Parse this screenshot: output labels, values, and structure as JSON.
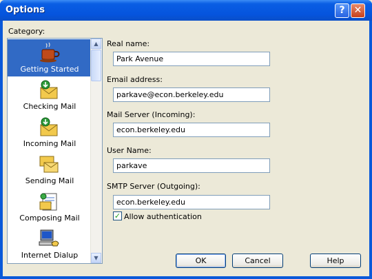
{
  "window": {
    "title": "Options"
  },
  "sidebar": {
    "label": "Category:",
    "items": [
      {
        "label": "Getting Started",
        "icon": "coffee-cup-icon",
        "selected": true
      },
      {
        "label": "Checking Mail",
        "icon": "mail-download-icon",
        "selected": false
      },
      {
        "label": "Incoming Mail",
        "icon": "mail-download-icon",
        "selected": false
      },
      {
        "label": "Sending Mail",
        "icon": "envelope-send-icon",
        "selected": false
      },
      {
        "label": "Composing Mail",
        "icon": "compose-mail-icon",
        "selected": false
      },
      {
        "label": "Internet Dialup",
        "icon": "computer-phone-icon",
        "selected": false
      }
    ]
  },
  "form": {
    "real_name": {
      "label": "Real name:",
      "value": "Park Avenue"
    },
    "email": {
      "label": "Email address:",
      "value": "parkave@econ.berkeley.edu"
    },
    "incoming_server": {
      "label": "Mail Server (Incoming):",
      "value": "econ.berkeley.edu"
    },
    "user_name": {
      "label": "User Name:",
      "value": "parkave"
    },
    "smtp_server": {
      "label": "SMTP Server (Outgoing):",
      "value": "econ.berkeley.edu"
    },
    "allow_auth": {
      "label": "Allow authentication",
      "checked": true
    }
  },
  "buttons": {
    "ok": "OK",
    "cancel": "Cancel",
    "help": "Help"
  },
  "colors": {
    "titlebar": "#0554DD",
    "selection": "#316AC5",
    "face": "#ECE9D8"
  }
}
